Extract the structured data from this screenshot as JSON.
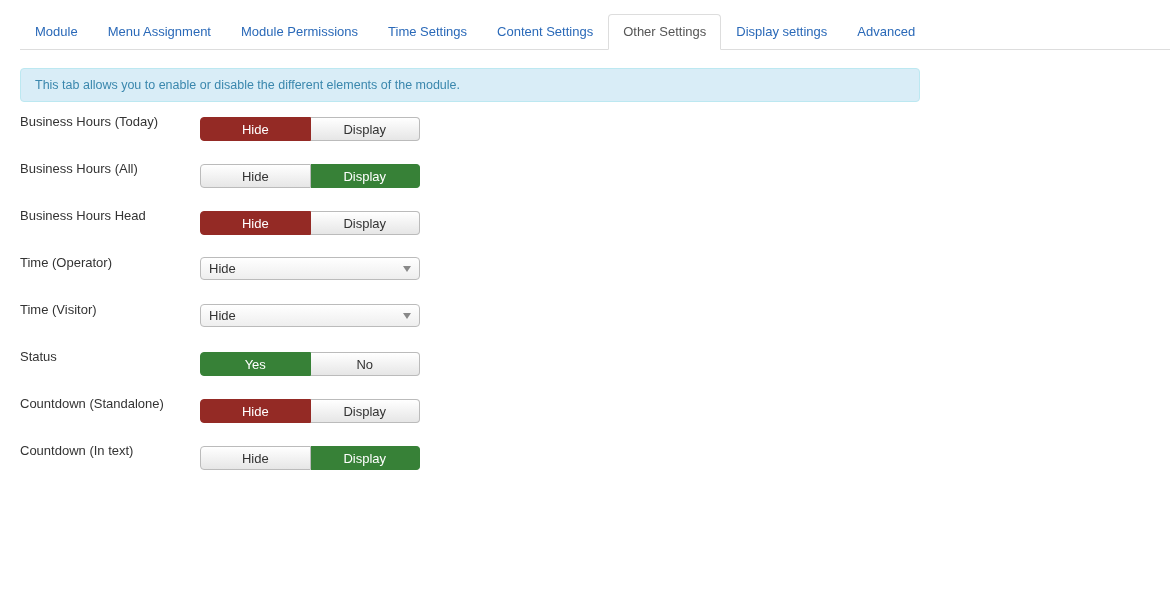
{
  "tabs": [
    {
      "label": "Module",
      "selected": false
    },
    {
      "label": "Menu Assignment",
      "selected": false
    },
    {
      "label": "Module Permissions",
      "selected": false
    },
    {
      "label": "Time Settings",
      "selected": false
    },
    {
      "label": "Content Settings",
      "selected": false
    },
    {
      "label": "Other Settings",
      "selected": true
    },
    {
      "label": "Display settings",
      "selected": false
    },
    {
      "label": "Advanced",
      "selected": false
    }
  ],
  "info": "This tab allows you to enable or disable the different elements of the module.",
  "fields": [
    {
      "label": "Business Hours (Today)",
      "kind": "toggle",
      "options": [
        {
          "label": "Hide",
          "selected": true,
          "kind": "negative"
        },
        {
          "label": "Display",
          "selected": false,
          "kind": "positive"
        }
      ]
    },
    {
      "label": "Business Hours (All)",
      "kind": "toggle",
      "options": [
        {
          "label": "Hide",
          "selected": false,
          "kind": "negative"
        },
        {
          "label": "Display",
          "selected": true,
          "kind": "positive"
        }
      ]
    },
    {
      "label": "Business Hours Head",
      "kind": "toggle",
      "options": [
        {
          "label": "Hide",
          "selected": true,
          "kind": "negative"
        },
        {
          "label": "Display",
          "selected": false,
          "kind": "positive"
        }
      ]
    },
    {
      "label": "Time (Operator)",
      "kind": "select",
      "value": "Hide"
    },
    {
      "label": "Time (Visitor)",
      "kind": "select",
      "value": "Hide"
    },
    {
      "label": "Status",
      "kind": "toggle",
      "options": [
        {
          "label": "Yes",
          "selected": true,
          "kind": "positive"
        },
        {
          "label": "No",
          "selected": false,
          "kind": "negative"
        }
      ]
    },
    {
      "label": "Countdown (Standalone)",
      "kind": "toggle",
      "options": [
        {
          "label": "Hide",
          "selected": true,
          "kind": "negative"
        },
        {
          "label": "Display",
          "selected": false,
          "kind": "positive"
        }
      ]
    },
    {
      "label": "Countdown (In text)",
      "kind": "toggle",
      "options": [
        {
          "label": "Hide",
          "selected": false,
          "kind": "negative"
        },
        {
          "label": "Display",
          "selected": true,
          "kind": "positive"
        }
      ]
    }
  ]
}
